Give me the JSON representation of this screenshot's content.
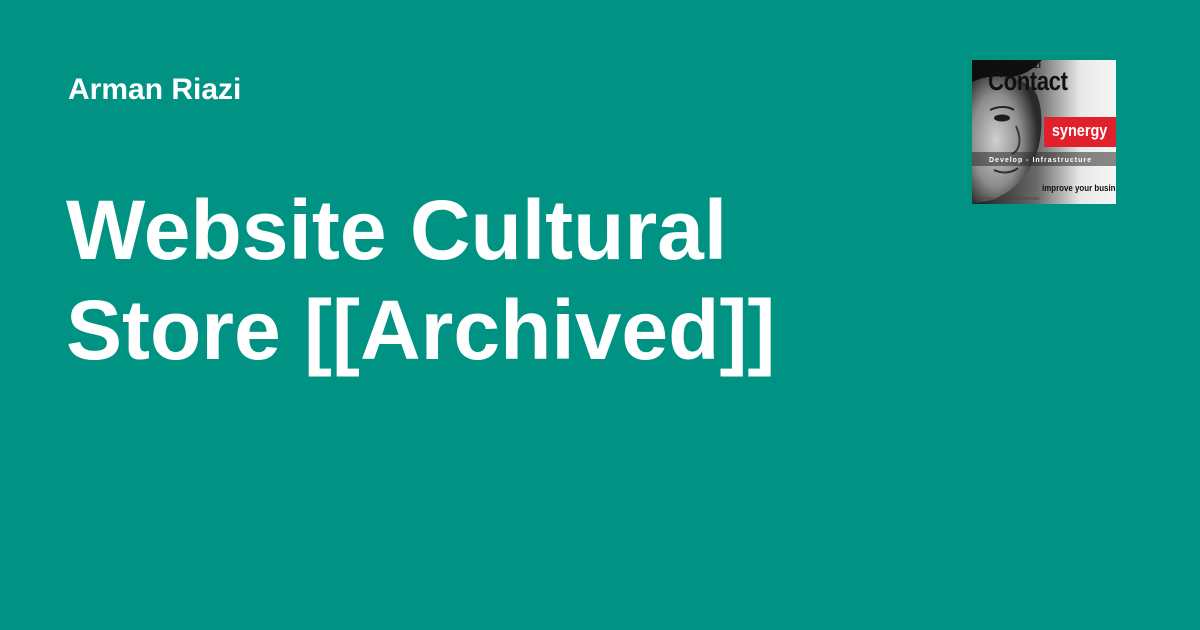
{
  "header": {
    "author_name": "Arman Riazi"
  },
  "main": {
    "title": "Website Cultural Store [[Archived]]"
  },
  "cover": {
    "author": "Arman Riazi",
    "headline": "Contact",
    "highlight": "synergy",
    "tagline": "Develop - Infrastructure",
    "slogan": "improve your business",
    "url": "anchor.com/riazi/arman"
  },
  "colors": {
    "background": "#009383",
    "text": "#ffffff",
    "accent_red": "#e0212b"
  }
}
